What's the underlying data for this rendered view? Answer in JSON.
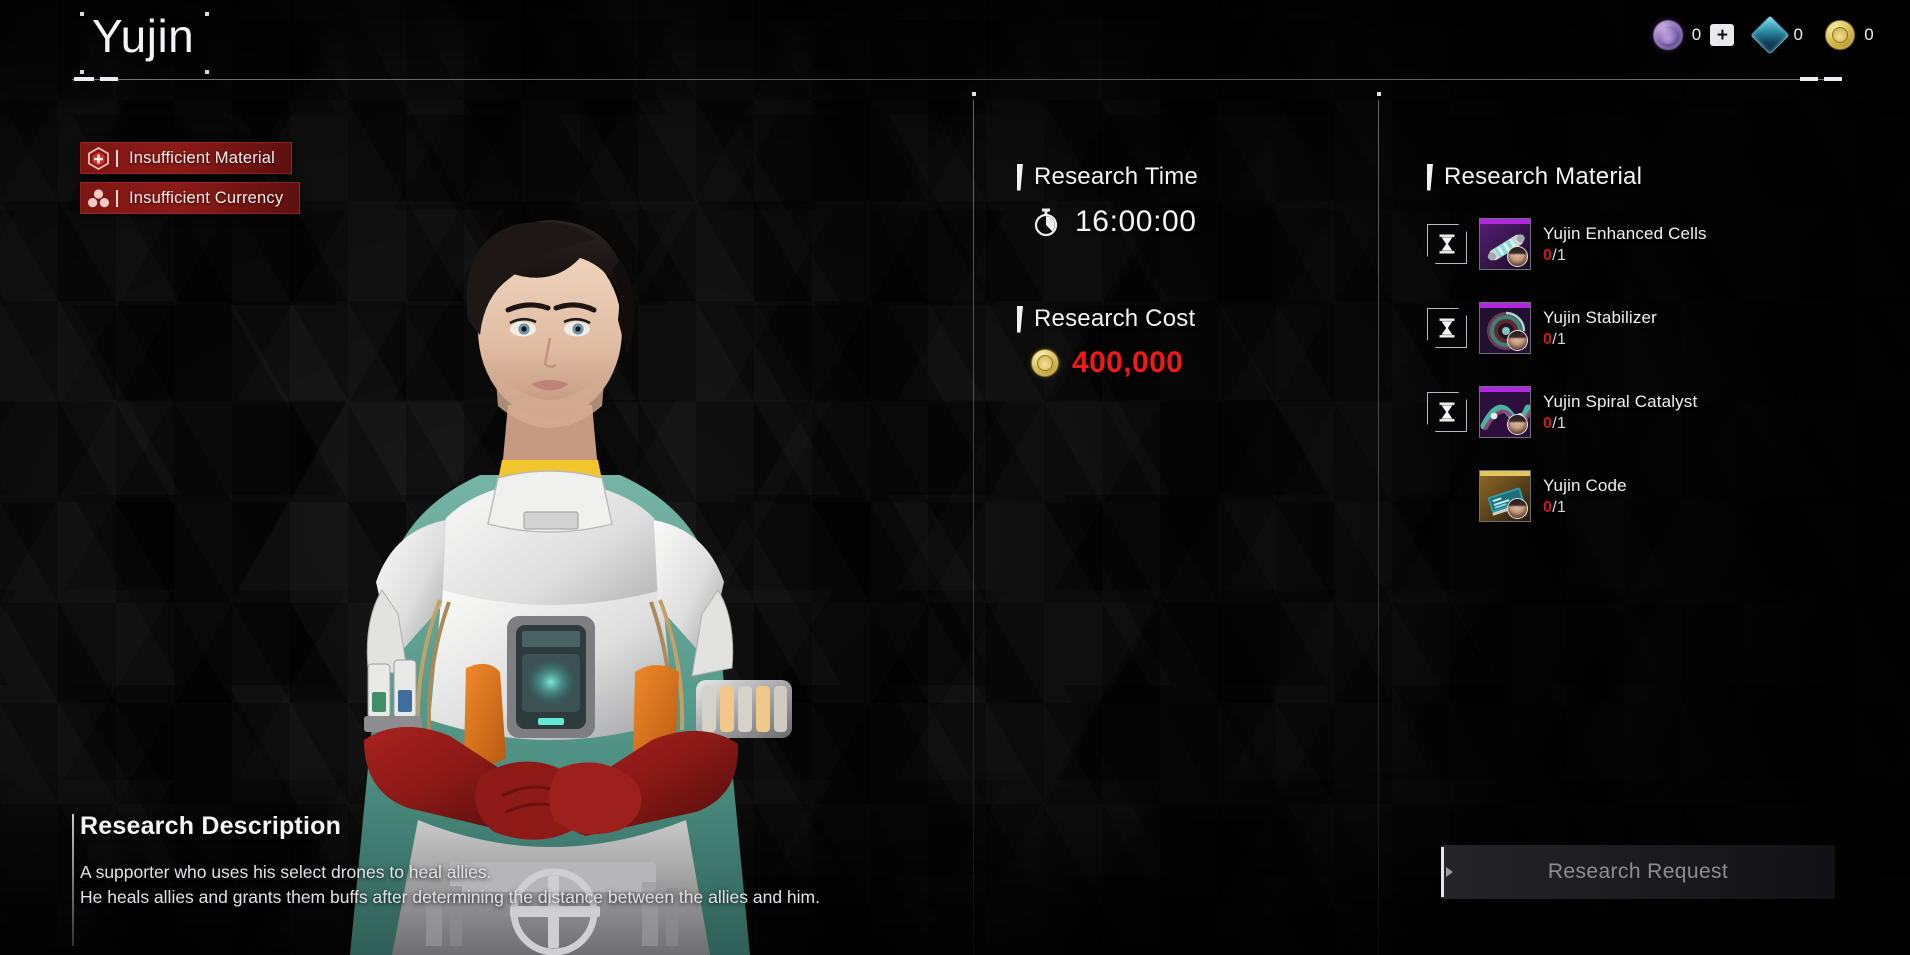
{
  "header": {
    "title": "Yujin",
    "currencies": [
      {
        "icon": "gacha-orb-icon",
        "value": "0",
        "has_plus": true,
        "plus_label": "+"
      },
      {
        "icon": "blue-crystal-icon",
        "value": "0",
        "has_plus": false
      },
      {
        "icon": "gold-coin-icon",
        "value": "0",
        "has_plus": false
      }
    ]
  },
  "status_badges": [
    {
      "icon": "hex-plus-icon",
      "label": "Insufficient Material"
    },
    {
      "icon": "three-coins-icon",
      "label": "Insufficient Currency"
    }
  ],
  "research_time": {
    "heading": "Research Time",
    "icon": "stopwatch-icon",
    "value": "16:00:00"
  },
  "research_cost": {
    "heading": "Research Cost",
    "icon": "gold-coin-icon",
    "value": "400,000",
    "value_color": "#f01818"
  },
  "research_material": {
    "heading": "Research Material",
    "items": [
      {
        "name": "Yujin Enhanced Cells",
        "have": "0",
        "need": "/1",
        "rarity_color": "#b327e0",
        "locked": true,
        "lock_icon": "hourglass-icon",
        "art": "cells"
      },
      {
        "name": "Yujin Stabilizer",
        "have": "0",
        "need": "/1",
        "rarity_color": "#b327e0",
        "locked": true,
        "lock_icon": "hourglass-icon",
        "art": "stabilizer"
      },
      {
        "name": "Yujin Spiral Catalyst",
        "have": "0",
        "need": "/1",
        "rarity_color": "#b327e0",
        "locked": true,
        "lock_icon": "hourglass-icon",
        "art": "catalyst"
      },
      {
        "name": "Yujin Code",
        "have": "0",
        "need": "/1",
        "rarity_color": "#e3c75a",
        "locked": false,
        "lock_icon": "",
        "art": "code"
      }
    ]
  },
  "research_request_button": {
    "label": "Research Request",
    "enabled": false
  },
  "description": {
    "heading": "Research Description",
    "body": "A supporter who uses his select drones to heal allies.\nHe heals allies and grants them buffs after determining the distance between the allies and him."
  }
}
